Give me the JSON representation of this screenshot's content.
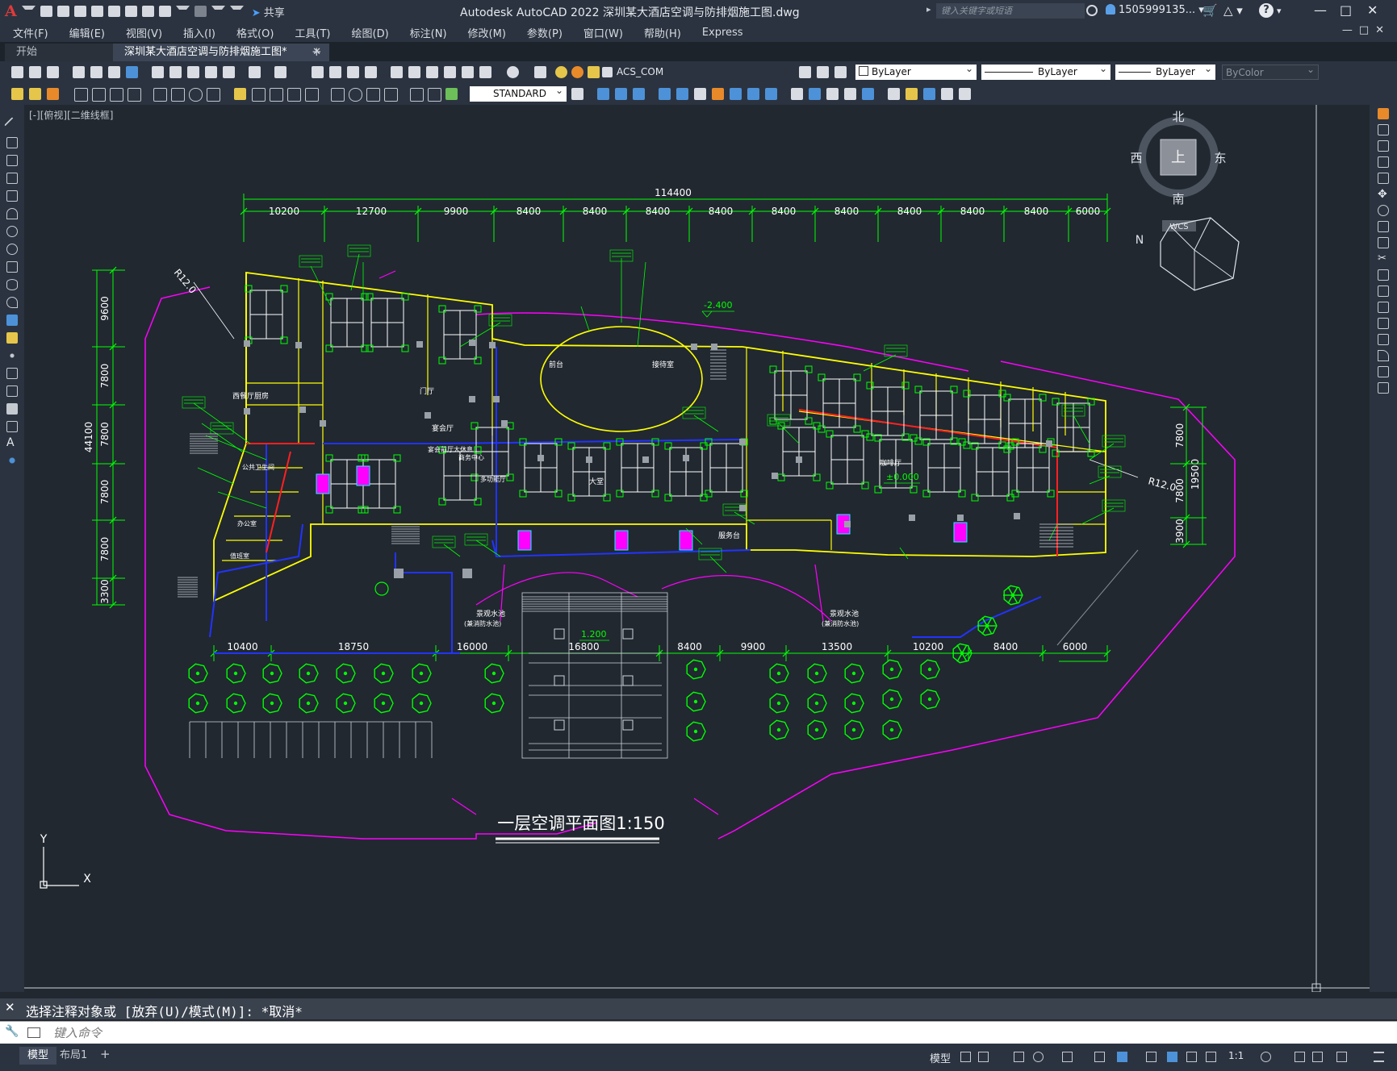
{
  "app": {
    "logo": "A",
    "title": "Autodesk AutoCAD 2022    深圳某大酒店空调与防排烟施工图.dwg",
    "share_label": "共享",
    "search_placeholder": "键入关键字或短语",
    "user": "1505999135...",
    "help": "?"
  },
  "menu": {
    "items": [
      "文件(F)",
      "编辑(E)",
      "视图(V)",
      "插入(I)",
      "格式(O)",
      "工具(T)",
      "绘图(D)",
      "标注(N)",
      "修改(M)",
      "参数(P)",
      "窗口(W)",
      "帮助(H)",
      "Express"
    ]
  },
  "tabs": {
    "start": "开始",
    "active": "深圳某大酒店空调与防排烟施工图*",
    "add": "+"
  },
  "properties": {
    "layer": "ACS_COM",
    "color": "ByLayer",
    "linetype": "ByLayer",
    "lineweight": "ByLayer",
    "plotstyle": "ByColor",
    "textstyle": "STANDARD"
  },
  "viewport": {
    "label": "[-][俯视][二维线框]"
  },
  "viewcube": {
    "north": "北",
    "south": "南",
    "east": "东",
    "west": "西",
    "top": "上",
    "wcs": "WCS",
    "wcs_prefix": "N"
  },
  "drawing": {
    "title": "一层空调平面图1:150",
    "total_width": "114400",
    "top_dims": [
      "10200",
      "12700",
      "9900",
      "8400",
      "8400",
      "8400",
      "8400",
      "8400",
      "8400",
      "8400",
      "8400",
      "8400",
      "6000"
    ],
    "bottom_dims": [
      "10400",
      "18750",
      "16000",
      "16800",
      "8400",
      "9900",
      "13500",
      "10200",
      "8400",
      "6000"
    ],
    "left_total": "44100",
    "left_dims": [
      "9600",
      "7800",
      "7800",
      "7800",
      "7800",
      "3300"
    ],
    "right_total": "19500",
    "right_dims": [
      "7800",
      "7800",
      "3900"
    ],
    "radius_left": "R12.0",
    "radius_right": "R12.0",
    "levels": [
      "-2.400",
      "±0.000",
      "1.200"
    ],
    "pool_left": "景观水池",
    "pool_left_sub": "(兼消防水池)",
    "pool_right": "景观水池",
    "pool_right_sub": "(兼消防水池)",
    "room_labels": [
      "西餐厅厨房",
      "门厅",
      "宴会厅",
      "服务台",
      "大堂",
      "公共卫生间",
      "咖啡厅",
      "多功能厅",
      "前台",
      "宴会前厅大休息",
      "接待室",
      "办公室",
      "值班室",
      "商务中心"
    ]
  },
  "ucs": {
    "x": "X",
    "y": "Y"
  },
  "command": {
    "history": "选择注释对象或 [放弃(U)/模式(M)]: *取消*",
    "placeholder": "键入命令"
  },
  "status": {
    "tab_model": "模型",
    "tab_layout": "布局1",
    "add": "+",
    "model_label": "模型",
    "scale": "1:1"
  },
  "colors": {
    "canvas_bg": "#212830",
    "wall": "#ffff00",
    "annotation": "#00ff00",
    "boundary": "#ff00ff",
    "duct_supply": "#0000ff",
    "duct_fire": "#ff0000",
    "dimension": "#00ff00"
  }
}
